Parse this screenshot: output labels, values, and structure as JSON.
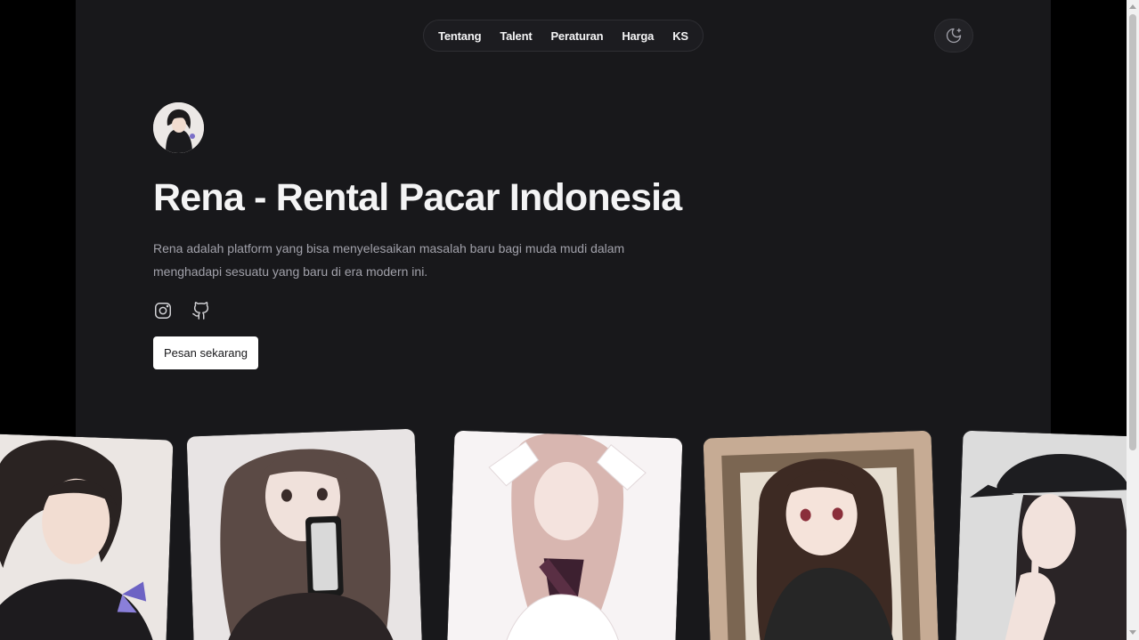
{
  "nav": {
    "items": [
      "Tentang",
      "Talent",
      "Peraturan",
      "Harga",
      "KS"
    ]
  },
  "theme_toggle": {
    "icon": "moon-star-icon"
  },
  "hero": {
    "title": "Rena - Rental Pacar Indonesia",
    "description": "Rena adalah platform yang bisa menyelesaikan masalah baru bagi muda mudi dalam menghadapi sesuatu yang baru di era modern ini.",
    "social": [
      "instagram-icon",
      "github-icon"
    ],
    "cta_label": "Pesan sekarang"
  },
  "gallery": {
    "photos": [
      "photo-1",
      "photo-2",
      "photo-3",
      "photo-4",
      "photo-5"
    ]
  },
  "colors": {
    "page_background": "#000000",
    "content_background": "#18181b",
    "text_primary": "#f4f4f5",
    "text_secondary": "#a1a1aa",
    "button_background": "#ffffff"
  }
}
